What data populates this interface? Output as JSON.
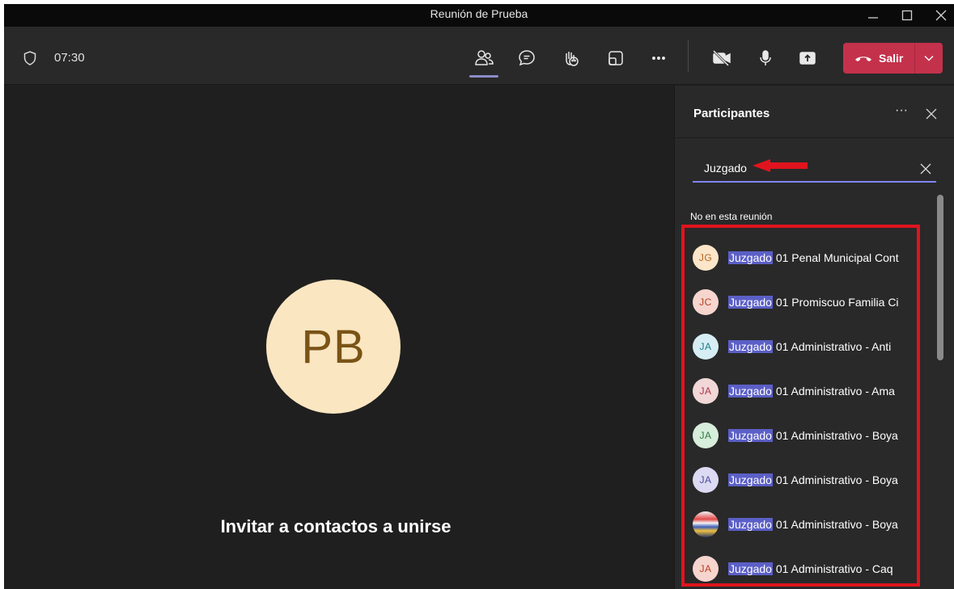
{
  "window": {
    "title": "Reunión de Prueba"
  },
  "toolbar": {
    "timer": "07:30",
    "leave_label": "Salir",
    "leave_color": "#c4314b"
  },
  "stage": {
    "avatar_initials": "PB",
    "invite_text": "Invitar a contactos a unirse"
  },
  "panel": {
    "title": "Participantes",
    "more_label": "···",
    "search_value": "Juzgado",
    "section_label": "No en esta reunión",
    "highlight_color": "#5b5fc7",
    "people": [
      {
        "initials": "JG",
        "match": "Juzgado",
        "rest": " 01 Penal Municipal Cont",
        "bg": "#fbe6c9",
        "fg": "#b3651f"
      },
      {
        "initials": "JC",
        "match": "Juzgado",
        "rest": " 01 Promiscuo Familia Ci",
        "bg": "#f6d5ce",
        "fg": "#b3411d"
      },
      {
        "initials": "JA",
        "match": "Juzgado",
        "rest": " 01 Administrativo - Anti",
        "bg": "#d6eef3",
        "fg": "#1a7a8f"
      },
      {
        "initials": "JA",
        "match": "Juzgado",
        "rest": " 01 Administrativo - Ama",
        "bg": "#f1d7d7",
        "fg": "#a8354b"
      },
      {
        "initials": "JA",
        "match": "Juzgado",
        "rest": " 01 Administrativo - Boya",
        "bg": "#d6eedb",
        "fg": "#2f7a3f"
      },
      {
        "initials": "JA",
        "match": "Juzgado",
        "rest": " 01 Administrativo - Boya",
        "bg": "#dcdaf2",
        "fg": "#4b4a9c"
      },
      {
        "initials": "",
        "match": "Juzgado",
        "rest": " 01 Administrativo - Boya",
        "bg": "#e9e2e6",
        "fg": "#555555"
      },
      {
        "initials": "JA",
        "match": "Juzgado",
        "rest": " 01 Administrativo - Caq",
        "bg": "#f6d5ce",
        "fg": "#b3411d"
      }
    ]
  }
}
